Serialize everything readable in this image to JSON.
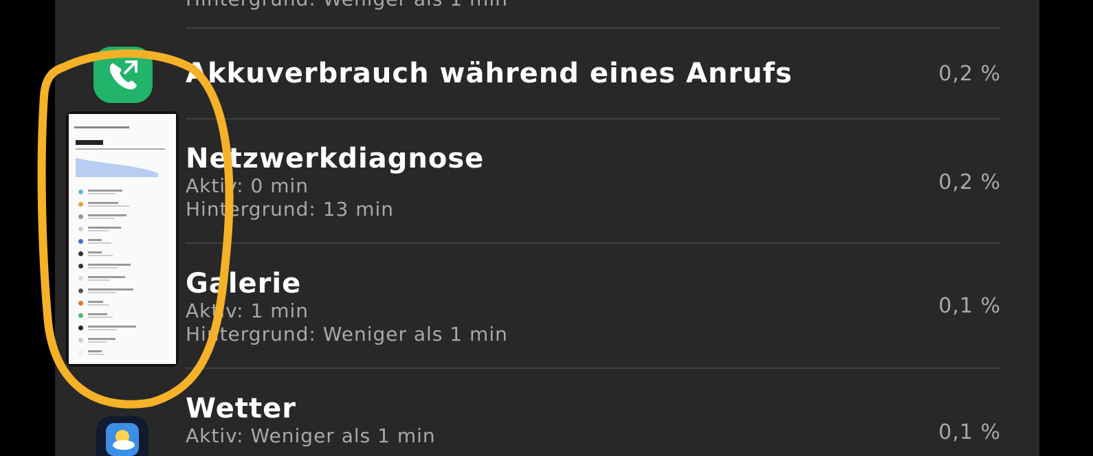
{
  "top_partial_subtitle": "Hintergrund: Weniger als 1 min",
  "items": [
    {
      "title": "Akkuverbrauch während eines Anrufs",
      "percent": "0,2 %",
      "icon": "phone-call-icon"
    },
    {
      "title": "Netzwerkdiagnose",
      "active": "Aktiv: 0 min",
      "background": "Hintergrund: 13 min",
      "percent": "0,2 %",
      "icon": "network-diagnosis-icon"
    },
    {
      "title": "Galerie",
      "active": "Aktiv: 1 min",
      "background": "Hintergrund: Weniger als 1 min",
      "percent": "0,1 %",
      "icon": "gallery-icon"
    },
    {
      "title": "Wetter",
      "active": "Aktiv: Weniger als 1 min",
      "percent": "0,1 %",
      "icon": "weather-icon"
    }
  ],
  "overlay_thumbnail": {
    "icon": "screenshot-thumbnail",
    "highlight_color": "#f5b128"
  },
  "colors": {
    "background": "#282828",
    "title": "#ffffff",
    "secondary": "#a9a9a9",
    "divider": "#404040",
    "call_icon": "#22b46a"
  }
}
